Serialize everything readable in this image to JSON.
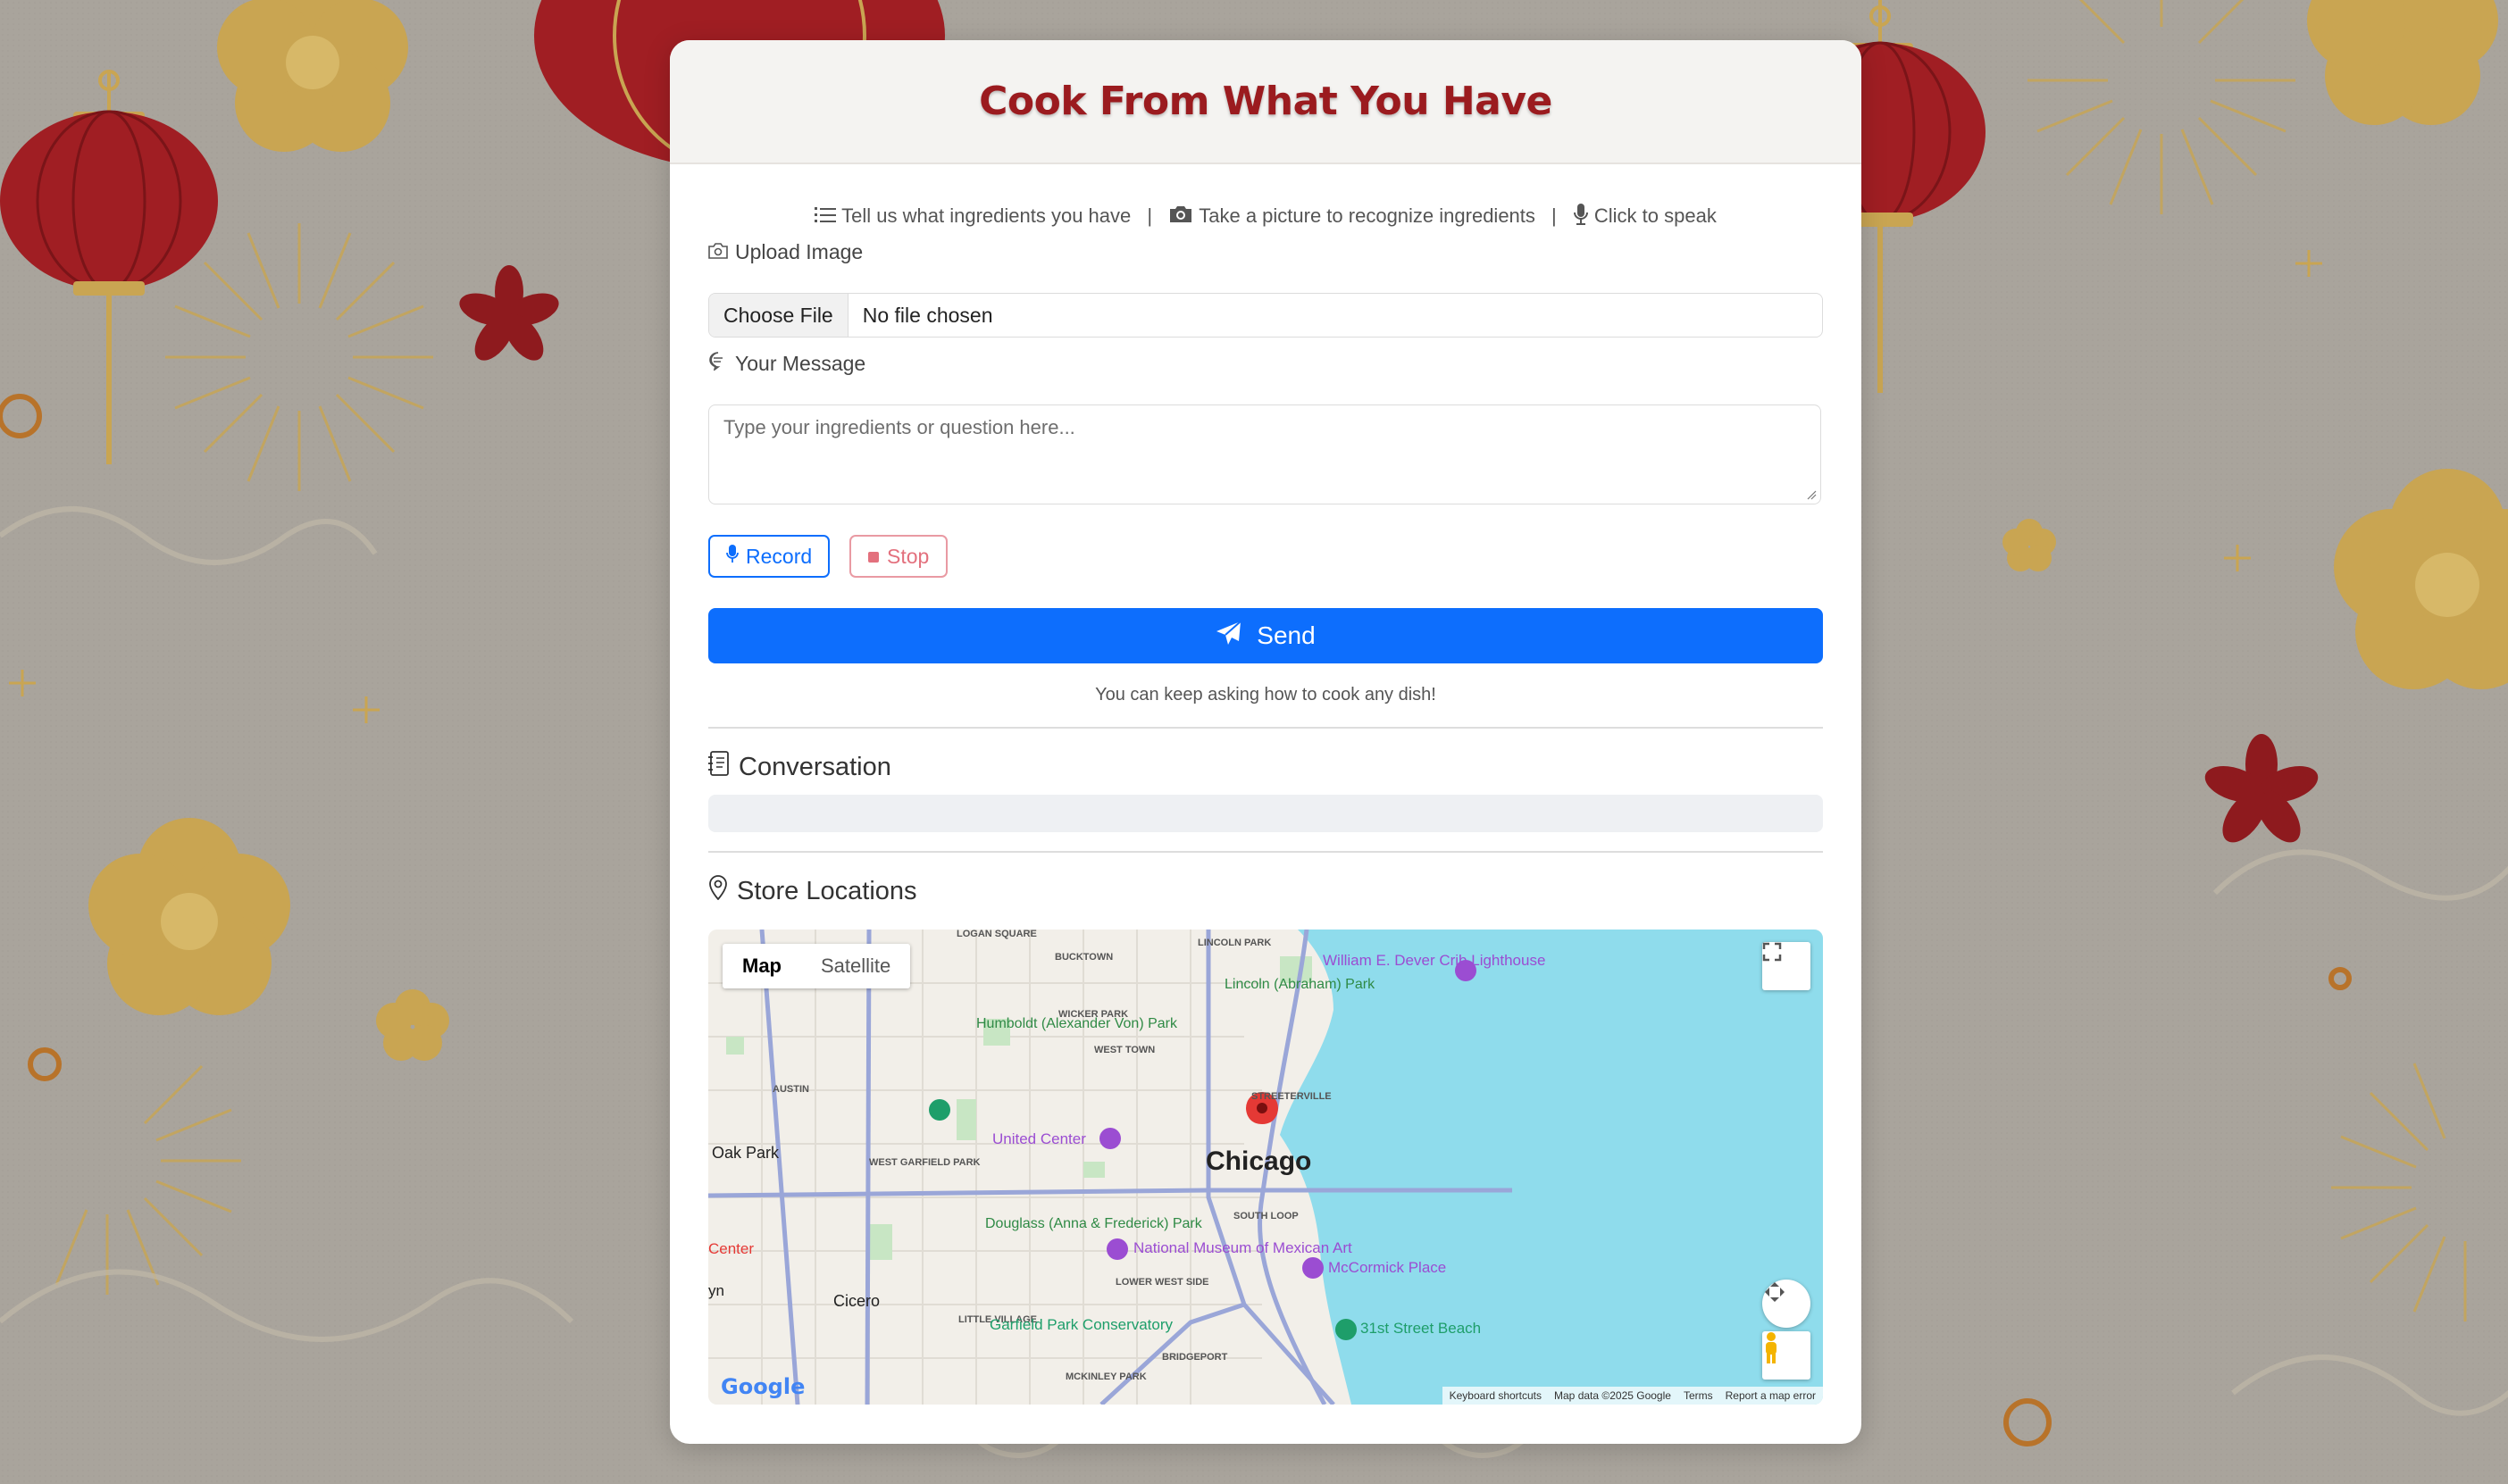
{
  "header": {
    "title": "Cook From What You Have"
  },
  "hints": [
    {
      "icon": "list-icon",
      "text": "Tell us what ingredients you have"
    },
    {
      "icon": "camera-icon",
      "text": "Take a picture to recognize ingredients"
    },
    {
      "icon": "microphone-icon",
      "text": "Click to speak"
    }
  ],
  "hint_separator": "|",
  "upload": {
    "label": "Upload Image",
    "button": "Choose File",
    "status": "No file chosen"
  },
  "message": {
    "label": "Your Message",
    "placeholder": "Type your ingredients or question here..."
  },
  "buttons": {
    "record": "Record",
    "stop": "Stop",
    "send": "Send"
  },
  "note": "You can keep asking how to cook any dish!",
  "conversation": {
    "title": "Conversation"
  },
  "stores": {
    "title": "Store Locations"
  },
  "map": {
    "type_map": "Map",
    "type_satellite": "Satellite",
    "city_label": "Chicago",
    "neighborhoods": [
      "LOGAN SQUARE",
      "BUCKTOWN",
      "LINCOLN PARK",
      "WICKER PARK",
      "WEST TOWN",
      "AUSTIN",
      "STREETERVILLE",
      "WEST GARFIELD PARK",
      "SOUTH LOOP",
      "LOWER WEST SIDE",
      "LITTLE VILLAGE",
      "BRIDGEPORT",
      "MCKINLEY PARK"
    ],
    "places": [
      "Oak Park",
      "Cicero",
      "Humboldt (Alexander Von) Park",
      "Lincoln (Abraham) Park",
      "Douglass (Anna & Frederick) Park"
    ],
    "pois": [
      "William E. Dever Crib Lighthouse",
      "Garfield Park Conservatory",
      "United Center",
      "National Museum of Mexican Art",
      "McCormick Place",
      "31st Street Beach"
    ],
    "edge_labels": [
      "Center",
      "yn"
    ],
    "logo": "Google",
    "footer": [
      "Keyboard shortcuts",
      "Map data ©2025 Google",
      "Terms",
      "Report a map error"
    ],
    "colors": {
      "water": "#8fdcec",
      "land": "#f2efe9",
      "highway": "#9aa6d8",
      "poi_purple": "#9b4dd2",
      "poi_green": "#1e9e6a",
      "marker": "#e53935"
    }
  },
  "colors": {
    "accent": "#0d6efd",
    "title_red": "#9b1b1f",
    "stop_pink": "#e3707d"
  }
}
